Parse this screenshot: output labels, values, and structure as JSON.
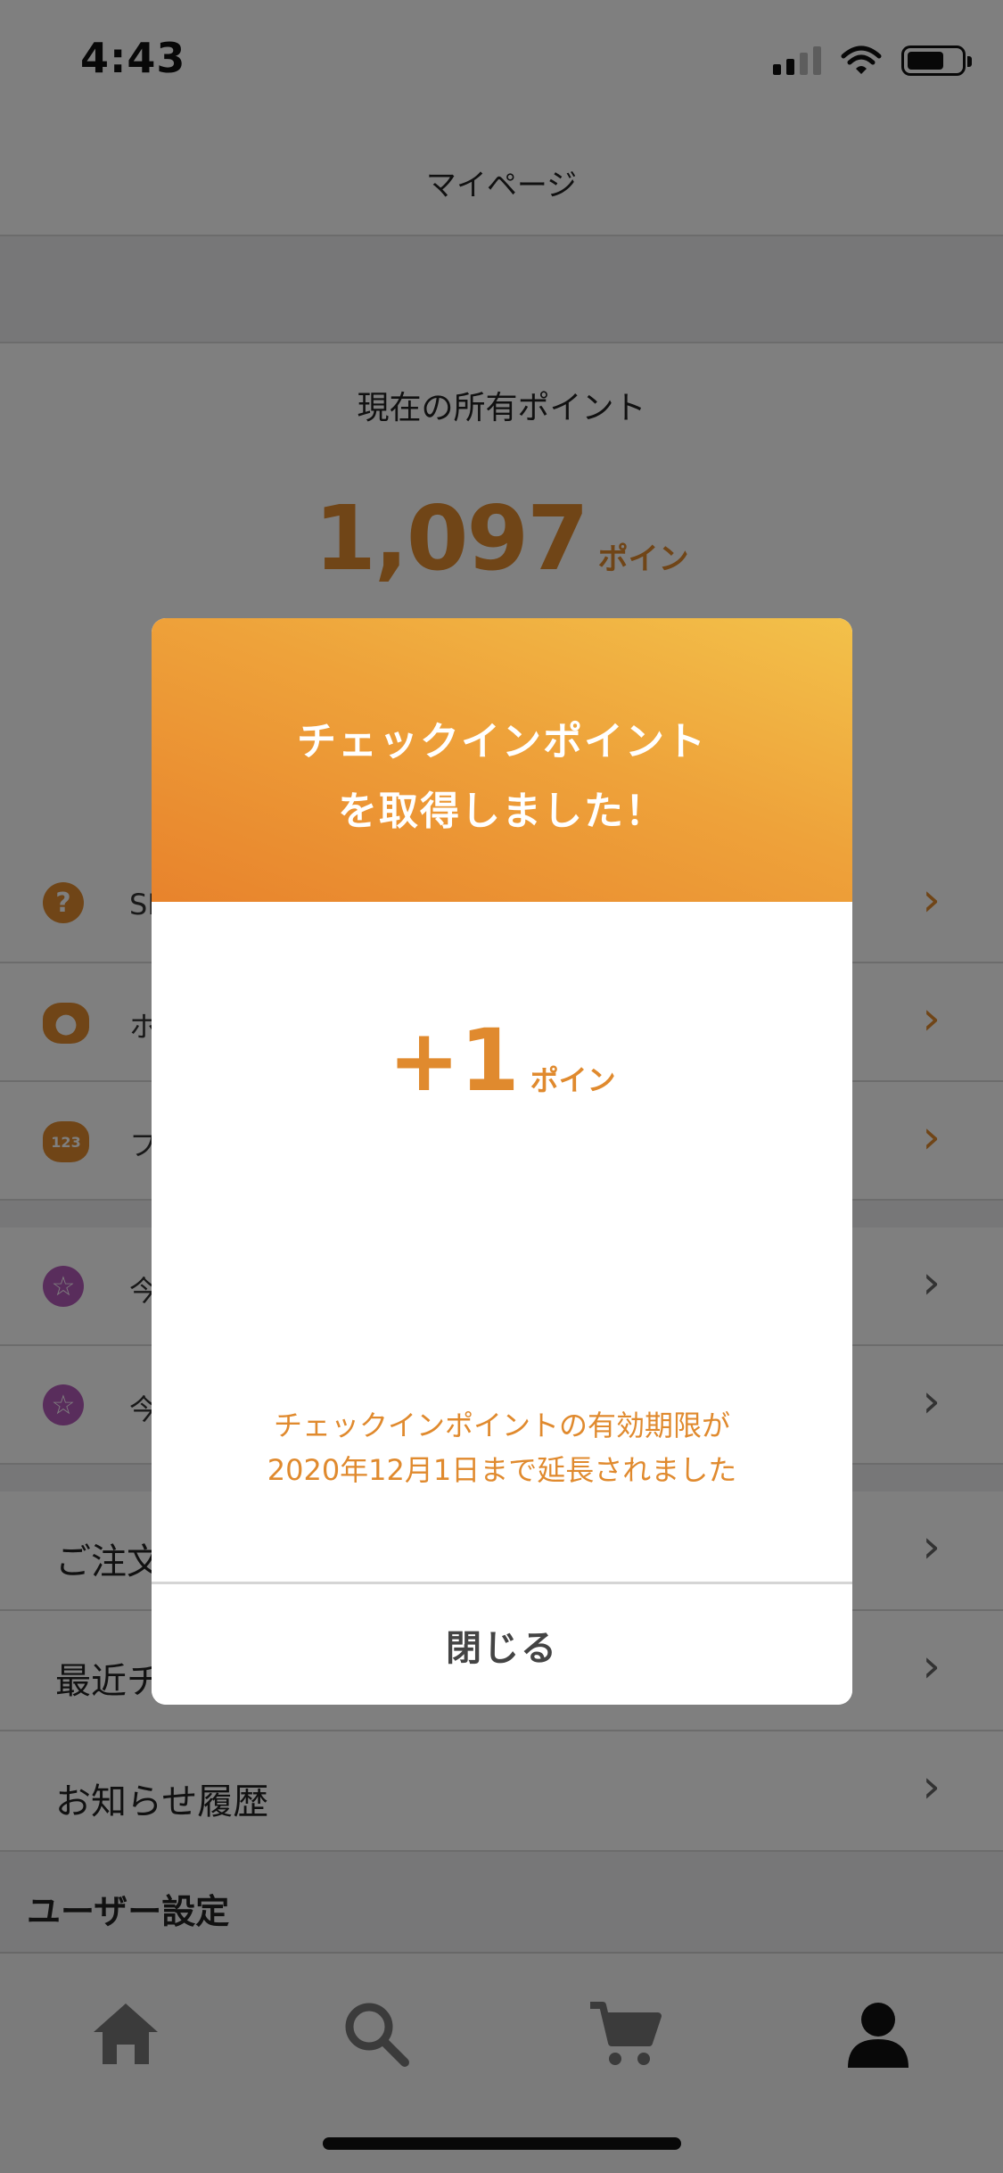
{
  "status_bar": {
    "time": "4:43"
  },
  "nav": {
    "title": "マイページ"
  },
  "points": {
    "label": "現在の所有ポイント",
    "value": "1,097",
    "unit": "ポイン"
  },
  "menu_rows": [
    {
      "text": "SI"
    },
    {
      "text": "ホ"
    },
    {
      "text": "フ"
    },
    {
      "text": "今"
    },
    {
      "text": "今"
    }
  ],
  "list_rows": [
    {
      "text": "ご注文"
    },
    {
      "text": "最近チ"
    },
    {
      "text": "お知らせ履歴"
    }
  ],
  "section": {
    "user_settings": "ユーザー設定"
  },
  "icons": {
    "help": "help-circle-icon",
    "pig": "piggy-bank-icon",
    "pig_123": "piggy-bank-123-icon",
    "star": "star-circle-icon",
    "home": "home-icon",
    "search": "search-icon",
    "cart": "cart-icon",
    "user": "user-icon"
  },
  "colors": {
    "accent": "#e08a2e",
    "header_gradient_start": "#f3c14a",
    "header_gradient_end": "#e8832c",
    "star_purple": "#b35ab8"
  },
  "modal": {
    "title_line1": "チェックインポイント",
    "title_line2": "を取得しました！",
    "points_value": "+1",
    "points_unit": "ポイン",
    "notice_line1": "チェックインポイントの有効期限が",
    "notice_line2": "2020年12月1日まで延長されました",
    "close_label": "閉じる"
  }
}
